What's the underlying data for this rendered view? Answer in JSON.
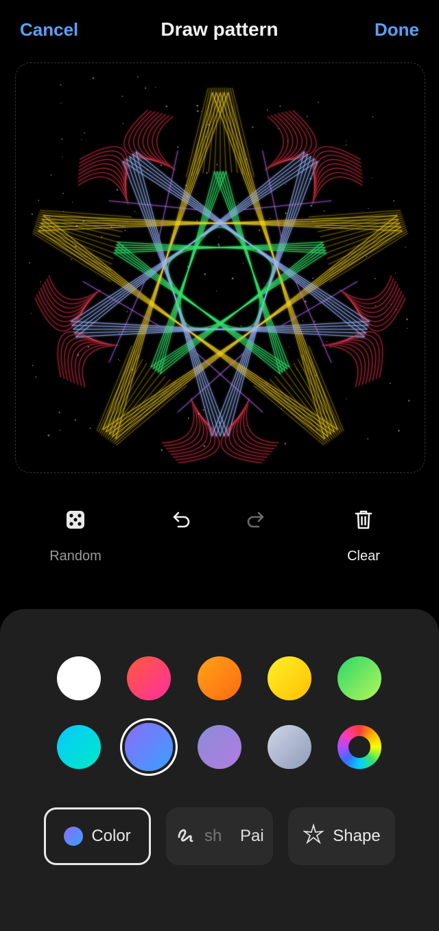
{
  "header": {
    "cancel": "Cancel",
    "title": "Draw pattern",
    "done": "Done"
  },
  "tools": {
    "random": {
      "label": "Random",
      "icon": "dice-icon"
    },
    "undo": {
      "icon": "undo-icon"
    },
    "redo": {
      "icon": "redo-icon"
    },
    "clear": {
      "label": "Clear",
      "icon": "trash-icon"
    }
  },
  "palette": {
    "swatches": [
      {
        "name": "white",
        "colors": [
          "#ffffff",
          "#ffffff"
        ]
      },
      {
        "name": "red-pink",
        "colors": [
          "#ff5a3a",
          "#ff2fa0"
        ]
      },
      {
        "name": "orange",
        "colors": [
          "#ffa316",
          "#ff6a12"
        ]
      },
      {
        "name": "yellow",
        "colors": [
          "#fff02a",
          "#ffbf00"
        ]
      },
      {
        "name": "green",
        "colors": [
          "#2ad86a",
          "#b5f55a"
        ]
      },
      {
        "name": "cyan",
        "colors": [
          "#08c9ff",
          "#00e8c6"
        ]
      },
      {
        "name": "blue-violet",
        "colors": [
          "#8a6cf7",
          "#3aa0ff"
        ],
        "selected": true
      },
      {
        "name": "lavender",
        "colors": [
          "#8c8cd8",
          "#b07ce0"
        ]
      },
      {
        "name": "gray-blue",
        "colors": [
          "#cfd6e6",
          "#8e9ab8"
        ]
      },
      {
        "name": "rainbow",
        "colors": [
          "rainbow",
          "rainbow"
        ]
      }
    ]
  },
  "tabs": {
    "color": "Color",
    "brush_a": "sh",
    "brush_b": "Pai",
    "shape": "Shape"
  }
}
